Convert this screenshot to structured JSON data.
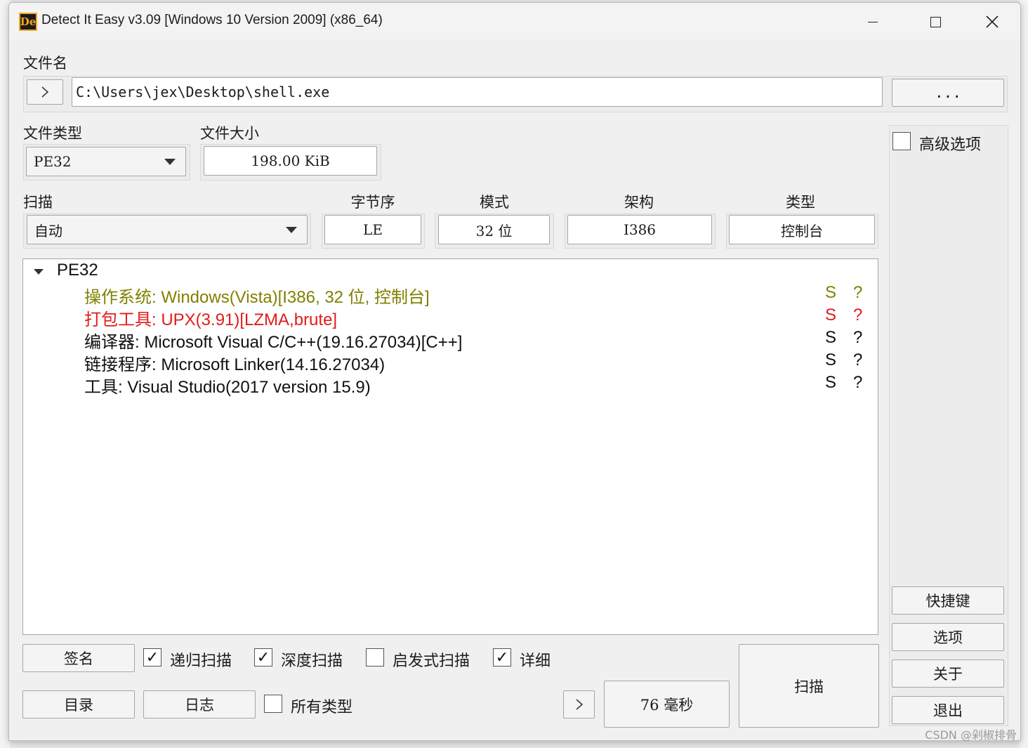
{
  "window": {
    "title": "Detect It Easy v3.09 [Windows 10 Version 2009] (x86_64)",
    "icon_text": "De"
  },
  "file": {
    "label": "文件名",
    "path": "C:\\Users\\jex\\Desktop\\shell.exe",
    "browse_label": "...",
    "nav_glyph": ">"
  },
  "file_type": {
    "label": "文件类型",
    "value": "PE32"
  },
  "file_size": {
    "label": "文件大小",
    "value": "198.00 KiB"
  },
  "scan": {
    "label": "扫描",
    "value": "自动"
  },
  "endianness": {
    "label": "字节序",
    "value": "LE"
  },
  "mode": {
    "label": "模式",
    "value": "32 位"
  },
  "arch": {
    "label": "架构",
    "value": "I386"
  },
  "type": {
    "label": "类型",
    "value": "控制台"
  },
  "advanced": {
    "label": "高级选项",
    "checked": false
  },
  "results": {
    "root": "PE32",
    "rows": [
      {
        "text": "操作系统: Windows(Vista)[I386, 32 位, 控制台]",
        "s": "S",
        "q": "?",
        "color": "#808000"
      },
      {
        "text": "打包工具: UPX(3.91)[LZMA,brute]",
        "s": "S",
        "q": "?",
        "color": "#e21b1b"
      },
      {
        "text": "编译器: Microsoft Visual C/C++(19.16.27034)[C++]",
        "s": "S",
        "q": "?",
        "color": "#111111"
      },
      {
        "text": "链接程序: Microsoft Linker(14.16.27034)",
        "s": "S",
        "q": "?",
        "color": "#111111"
      },
      {
        "text": "工具: Visual Studio(2017 version 15.9)",
        "s": "S",
        "q": "?",
        "color": "#111111"
      }
    ]
  },
  "buttons": {
    "signatures": "签名",
    "directory": "目录",
    "log": "日志",
    "scan": "扫描",
    "shortcuts": "快捷键",
    "options": "选项",
    "about": "关于",
    "exit": "退出",
    "next_glyph": ">"
  },
  "options_checks": {
    "recursive": {
      "label": "递归扫描",
      "checked": true
    },
    "deep": {
      "label": "深度扫描",
      "checked": true
    },
    "heuristic": {
      "label": "启发式扫描",
      "checked": false
    },
    "verbose": {
      "label": "详细",
      "checked": true
    },
    "all_types": {
      "label": "所有类型",
      "checked": false
    }
  },
  "elapsed": "76 毫秒",
  "watermark": "CSDN @剁椒排骨"
}
